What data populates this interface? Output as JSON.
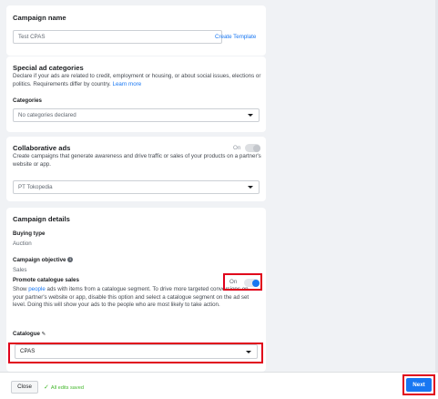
{
  "campaign_name": {
    "title": "Campaign name",
    "input_value": "Test CPAS",
    "create_template_link": "Create Template"
  },
  "special_ad": {
    "title": "Special ad categories",
    "description": "Declare if your ads are related to credit, employment or housing, or about social issues, elections or politics. Requirements differ by country.",
    "learn_more": "Learn more",
    "categories_label": "Categories",
    "categories_placeholder": "No categories declared"
  },
  "collaborative_ads": {
    "title": "Collaborative ads",
    "toggle_label": "On",
    "description": "Create campaigns that generate awareness and drive traffic or sales of your products on a partner's website or app.",
    "partner_value": "PT Tokopedia"
  },
  "campaign_details": {
    "title": "Campaign details",
    "buying_type_label": "Buying type",
    "buying_type_value": "Auction",
    "objective_label": "Campaign objective",
    "objective_value": "Sales",
    "promote_label": "Promote catalogue sales",
    "promote_toggle_label": "On",
    "promote_desc_prefix": "Show",
    "promote_desc_link": "people",
    "promote_desc_rest": "ads with items from a catalogue segment. To drive more targeted conversions on your partner's website or app, disable this option and select a catalogue segment on the ad set level. Doing this will show your ads to the people who are most likely to take action.",
    "catalogue_label": "Catalogue",
    "catalogue_value": "CPAS"
  },
  "footer": {
    "close_label": "Close",
    "saved_status": "All edits saved",
    "next_label": "Next"
  },
  "colors": {
    "accent": "#1877f2",
    "highlight": "#e0001b",
    "success": "#42b72a"
  }
}
